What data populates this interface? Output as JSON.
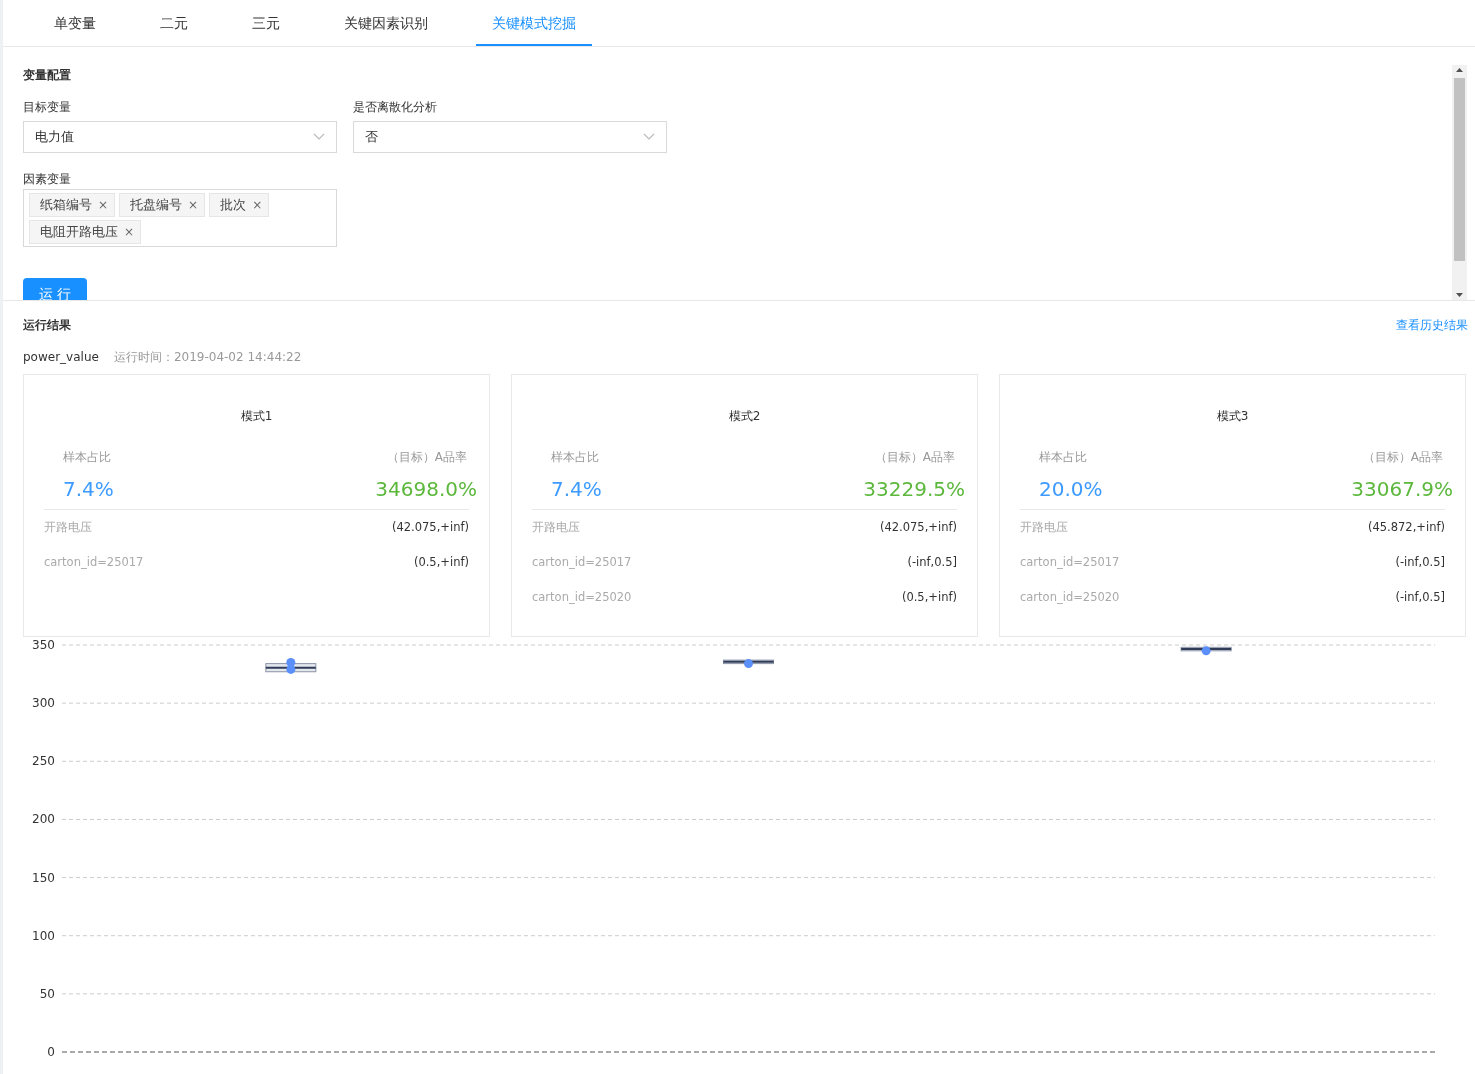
{
  "tabs": [
    {
      "label": "单变量",
      "selected": false
    },
    {
      "label": "二元",
      "selected": false
    },
    {
      "label": "三元",
      "selected": false
    },
    {
      "label": "关键因素识别",
      "selected": false
    },
    {
      "label": "关键模式挖掘",
      "selected": true
    }
  ],
  "config": {
    "title": "变量配置",
    "target": {
      "label": "目标变量",
      "value": "电力值"
    },
    "discretize": {
      "label": "是否离散化分析",
      "value": "否"
    },
    "factors": {
      "label": "因素变量",
      "tags": [
        {
          "label": "纸箱编号",
          "remove": "×"
        },
        {
          "label": "托盘编号",
          "remove": "×"
        },
        {
          "label": "批次",
          "remove": "×"
        },
        {
          "label": "电阻开路电压",
          "remove": "×"
        }
      ]
    },
    "run_button": "运 行"
  },
  "results": {
    "title": "运行结果",
    "history_link": "查看历史结果",
    "target_name": "power_value",
    "run_time": "运行时间：2019-04-02 14:44:22",
    "cards": [
      {
        "title": "模式1",
        "sample_label": "样本占比",
        "target_label": "（目标）A品率",
        "sample_value": "7.4%",
        "target_value": "34698.0%",
        "conditions": [
          {
            "name": "开路电压",
            "range": "(42.075,+inf)"
          },
          {
            "name": "carton_id=25017",
            "range": "(0.5,+inf)"
          }
        ]
      },
      {
        "title": "模式2",
        "sample_label": "样本占比",
        "target_label": "（目标）A品率",
        "sample_value": "7.4%",
        "target_value": "33229.5%",
        "conditions": [
          {
            "name": "开路电压",
            "range": "(42.075,+inf)"
          },
          {
            "name": "carton_id=25017",
            "range": "(-inf,0.5]"
          },
          {
            "name": "carton_id=25020",
            "range": "(0.5,+inf)"
          }
        ]
      },
      {
        "title": "模式3",
        "sample_label": "样本占比",
        "target_label": "（目标）A品率",
        "sample_value": "20.0%",
        "target_value": "33067.9%",
        "conditions": [
          {
            "name": "开路电压",
            "range": "(45.872,+inf)"
          },
          {
            "name": "carton_id=25017",
            "range": "(-inf,0.5]"
          },
          {
            "name": "carton_id=25020",
            "range": "(-inf,0.5]"
          }
        ]
      }
    ],
    "chart_data": {
      "type": "scatter",
      "grid": true,
      "categories": [
        null,
        null,
        null
      ],
      "ylim": [
        0,
        350
      ],
      "yticks": [
        0,
        50,
        100,
        150,
        200,
        250,
        300,
        350
      ],
      "series": [
        {
          "color": "#5b8ff9",
          "values": [
            335,
            334,
            345
          ]
        },
        {
          "color": "#5b8ff9",
          "values": [
            329,
            null,
            null
          ]
        }
      ]
    }
  }
}
